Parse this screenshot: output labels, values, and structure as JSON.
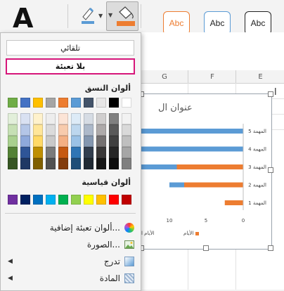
{
  "colors": {
    "accent": "#d6167a",
    "chart_blue": "#5b9bd5",
    "chart_orange": "#ed7d31"
  },
  "ribbon": {
    "font_glyph": "A",
    "styles": [
      {
        "label": "Abc",
        "border": "#ed7d31",
        "color": "#ed7d31"
      },
      {
        "label": "Abc",
        "border": "#5b9bd5",
        "color": "#222222"
      },
      {
        "label": "Abc",
        "border": "#222222",
        "color": "#222222"
      }
    ]
  },
  "sheet": {
    "columns": [
      "G",
      "F",
      "E"
    ],
    "cut_text": "ا"
  },
  "chart": {
    "title_fragment": "عنوان ال",
    "legend": [
      "الأيام",
      "الأيام ا"
    ]
  },
  "chart_data": {
    "type": "bar",
    "orientation": "horizontal",
    "categories": [
      "المهمة 5",
      "المهمة 4",
      "المهمة 3",
      "المهمة 2",
      "المهمة 1"
    ],
    "series": [
      {
        "name": "الأيام",
        "color": "#ed7d31",
        "values": [
          0,
          0,
          9,
          8,
          2.5
        ]
      },
      {
        "name": "الأيام ا",
        "color": "#5b9bd5",
        "values": [
          20,
          20,
          11,
          2,
          0
        ]
      }
    ],
    "x_ticks": [
      "10",
      "5",
      "0"
    ],
    "xlim": [
      0,
      12
    ]
  },
  "dropdown": {
    "automatic_label": "تلقائي",
    "no_fill_label": "بلا تعبئة",
    "theme_colors_label": "ألوان النسق",
    "standard_colors_label": "ألوان قياسية",
    "theme_row": [
      "#70ad47",
      "#4472c4",
      "#ffc000",
      "#a5a5a5",
      "#ed7d31",
      "#5b9bd5",
      "#44546a",
      "#e7e6e6",
      "#000000",
      "#ffffff"
    ],
    "theme_shades": [
      [
        "#e2efda",
        "#c6e0b4",
        "#a9d08e",
        "#548235",
        "#375623"
      ],
      [
        "#d9e1f2",
        "#b4c6e7",
        "#8ea9db",
        "#2f5597",
        "#1f3864"
      ],
      [
        "#fff2cc",
        "#ffe699",
        "#ffd966",
        "#bf8f00",
        "#806000"
      ],
      [
        "#ededed",
        "#dbdbdb",
        "#c9c9c9",
        "#7b7b7b",
        "#525252"
      ],
      [
        "#fce4d6",
        "#f8cbad",
        "#f4b084",
        "#c65911",
        "#833c0c"
      ],
      [
        "#ddebf7",
        "#bdd7ee",
        "#9bc2e6",
        "#2f75b5",
        "#1f4e78"
      ],
      [
        "#d6dce4",
        "#adb9ca",
        "#8497b0",
        "#333f4f",
        "#222b35"
      ],
      [
        "#d0cece",
        "#aeaaaa",
        "#757171",
        "#3a3838",
        "#161616"
      ],
      [
        "#7f7f7f",
        "#595959",
        "#404040",
        "#262626",
        "#0d0d0d"
      ],
      [
        "#f2f2f2",
        "#d9d9d9",
        "#bfbfbf",
        "#a6a6a6",
        "#808080"
      ]
    ],
    "standard_row": [
      "#7030a0",
      "#002060",
      "#0070c0",
      "#00b0f0",
      "#00b050",
      "#92d050",
      "#ffff00",
      "#ffc000",
      "#ff0000",
      "#c00000"
    ],
    "menu": [
      {
        "label": "ألوان تعبئة إضافية...",
        "icon": "color-wheel-icon"
      },
      {
        "label": "الصورة...",
        "icon": "picture-icon"
      },
      {
        "label": "تدرج",
        "icon": "gradient-icon",
        "submenu": true
      },
      {
        "label": "المادة",
        "icon": "texture-icon",
        "submenu": true
      }
    ]
  }
}
